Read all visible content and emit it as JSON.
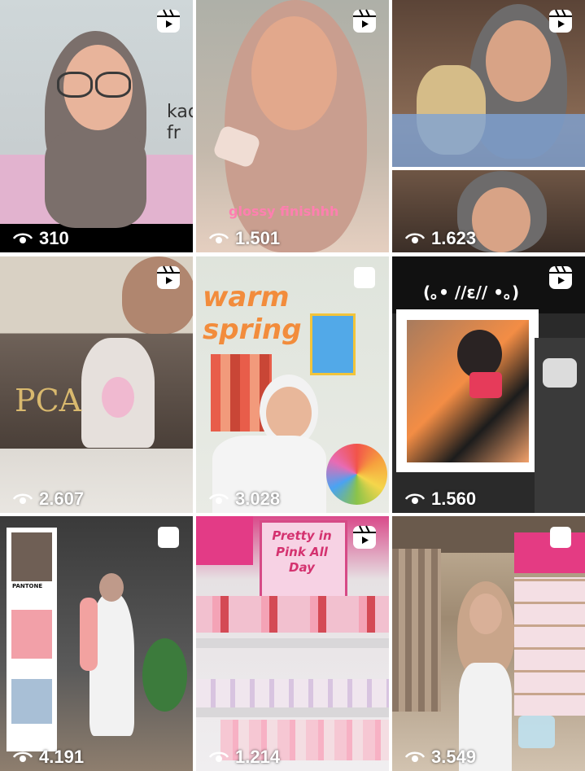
{
  "grid": {
    "posts": [
      {
        "views": "310",
        "type": "reel",
        "overlay": "kad\nfr"
      },
      {
        "views": "1.501",
        "type": "reel",
        "overlay": "glossy finishhh"
      },
      {
        "views": "1.623",
        "type": "reel",
        "overlay": ""
      },
      {
        "views": "2.607",
        "type": "reel",
        "overlay": "PCA"
      },
      {
        "views": "3.028",
        "type": "carousel",
        "overlay": "warm spring"
      },
      {
        "views": "1.560",
        "type": "reel",
        "overlay": "(｡• //ε// •｡)"
      },
      {
        "views": "4.191",
        "type": "carousel",
        "overlay": "PANTONE"
      },
      {
        "views": "1.214",
        "type": "reel",
        "overlay": "Pretty in Pink All Day"
      },
      {
        "views": "3.549",
        "type": "carousel",
        "overlay": ""
      }
    ]
  },
  "colors": {
    "reel_icon": "#ffffff",
    "text": "#ffffff"
  }
}
